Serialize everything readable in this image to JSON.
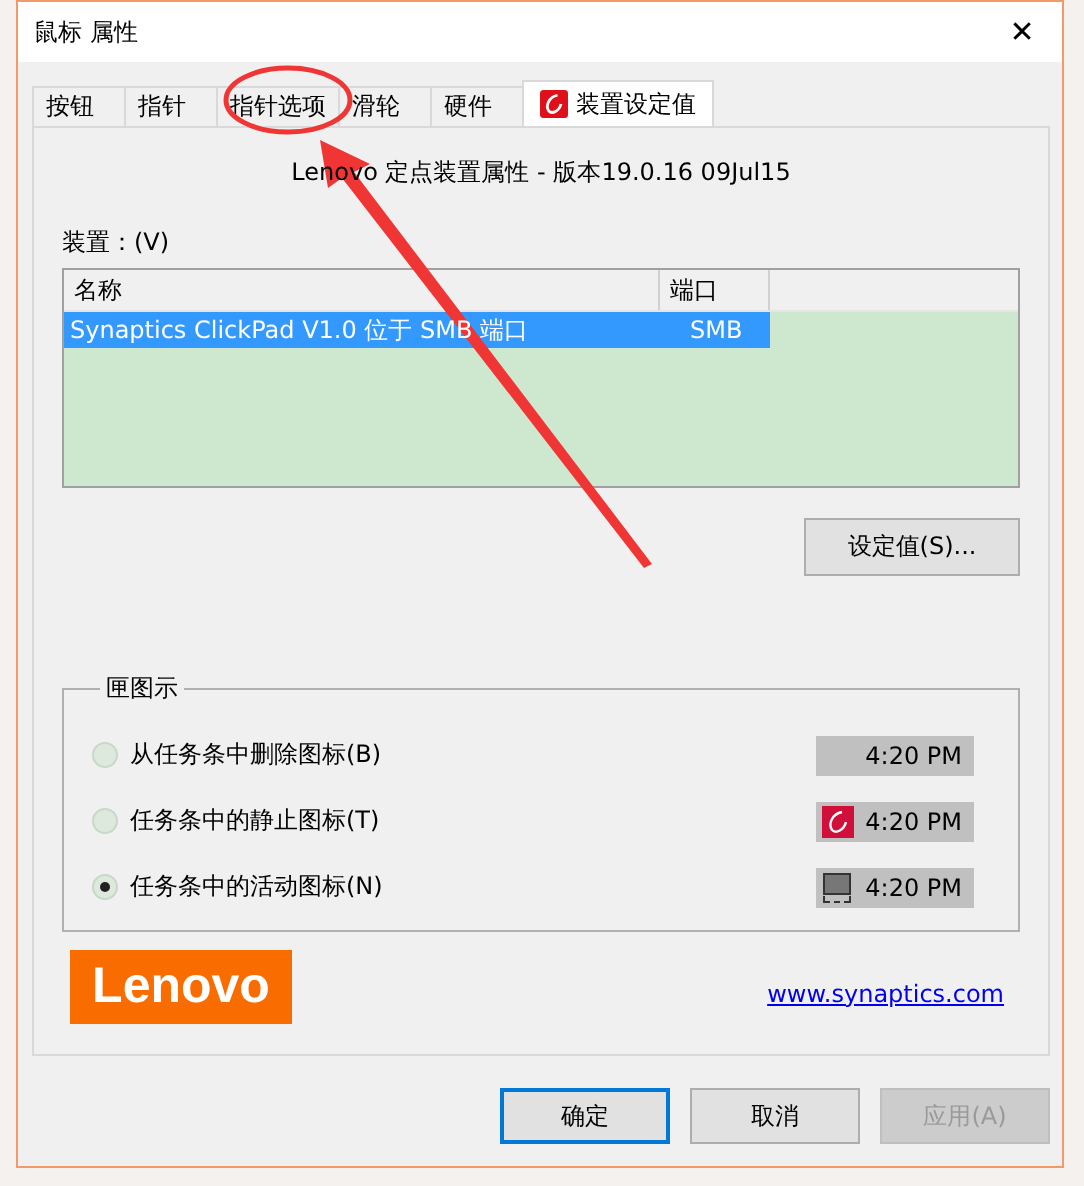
{
  "window": {
    "title": "鼠标 属性",
    "close": "✕"
  },
  "tabs": [
    {
      "label": "按钮",
      "selected": false,
      "kind": "plain"
    },
    {
      "label": "指针",
      "selected": false,
      "kind": "plain"
    },
    {
      "label": "指针选项",
      "selected": false,
      "kind": "plain"
    },
    {
      "label": "滑轮",
      "selected": false,
      "kind": "plain"
    },
    {
      "label": "硬件",
      "selected": false,
      "kind": "plain"
    },
    {
      "label": "装置设定值",
      "selected": true,
      "kind": "app"
    }
  ],
  "version_text": "Lenovo 定点装置属性 - 版本19.0.16 09Jul15",
  "devices": {
    "label": "装置：(V)",
    "columns": [
      "名称",
      "端口"
    ],
    "rows": [
      {
        "name": "Synaptics ClickPad V1.0 位于 SMB 端口",
        "port": "SMB",
        "selected": true
      }
    ]
  },
  "settings_button": "设定值(S)...",
  "tray_group": {
    "legend": "匣图示",
    "options": [
      {
        "label": "从任务条中删除图标(B)",
        "selected": false,
        "time": "4:20 PM",
        "kind": "blank"
      },
      {
        "label": "任务条中的静止图标(T)",
        "selected": false,
        "time": "4:20 PM",
        "kind": "app"
      },
      {
        "label": "任务条中的活动图标(N)",
        "selected": true,
        "time": "4:20 PM",
        "kind": "monitor"
      }
    ]
  },
  "logo": "Lenovo",
  "link": "www.synaptics.com",
  "buttons": [
    {
      "label": "确定",
      "default": true,
      "disabled": false
    },
    {
      "label": "取消",
      "default": false,
      "disabled": false
    },
    {
      "label": "应用(A)",
      "default": false,
      "disabled": true
    }
  ]
}
